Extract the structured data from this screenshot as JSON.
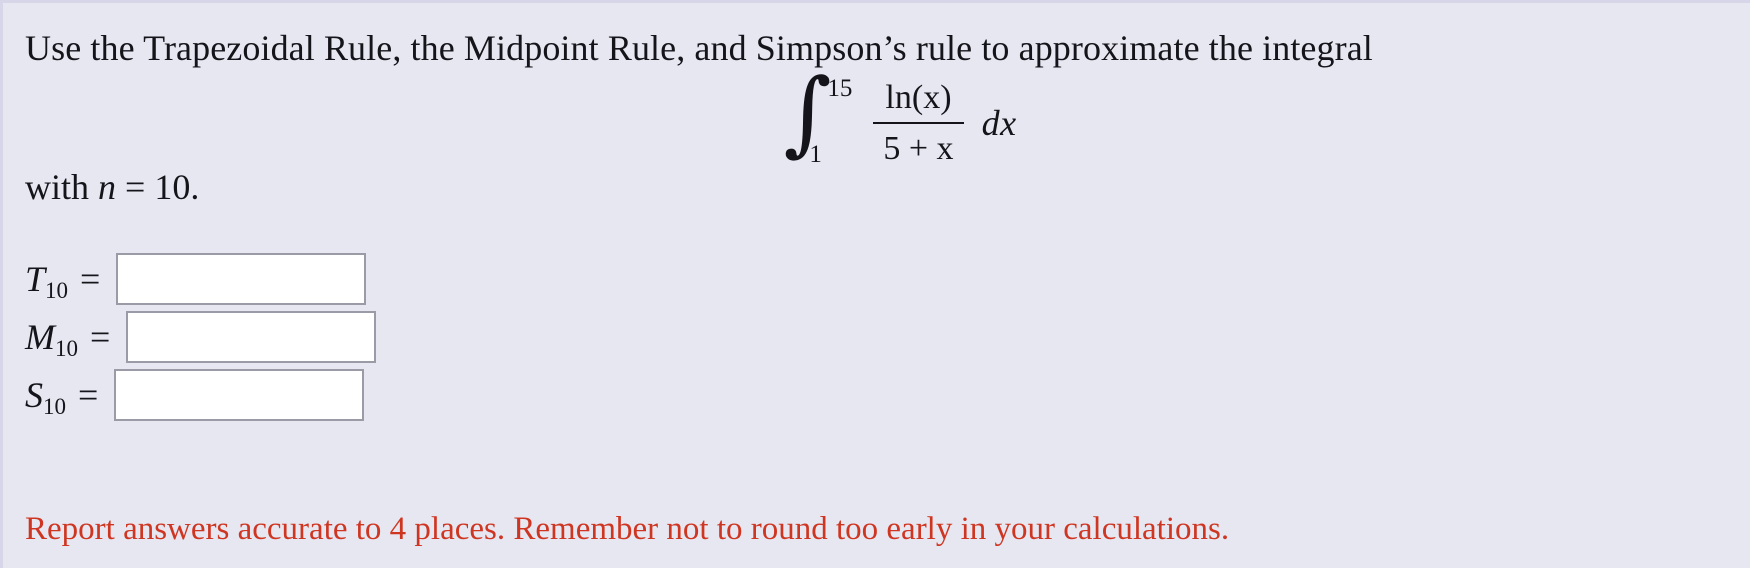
{
  "problem": {
    "prompt": "Use the Trapezoidal Rule, the Midpoint Rule, and Simpson’s rule to approximate the integral",
    "integral": {
      "sign": "∫",
      "lower_limit": "1",
      "upper_limit": "15",
      "numerator": "ln(x)",
      "denominator": "5 + x",
      "differential": "dx"
    },
    "condition_prefix": "with ",
    "condition_var": "n",
    "condition_eq": " = ",
    "condition_value": "10."
  },
  "answers": [
    {
      "id": "trapezoidal",
      "base": "T",
      "sub": "10",
      "eq": "=",
      "value": "",
      "placeholder": ""
    },
    {
      "id": "midpoint",
      "base": "M",
      "sub": "10",
      "eq": "=",
      "value": "",
      "placeholder": ""
    },
    {
      "id": "simpson",
      "base": "S",
      "sub": "10",
      "eq": "=",
      "value": "",
      "placeholder": ""
    }
  ],
  "note": {
    "text": "Report answers accurate to 4 places. Remember not to round too early in your calculations.",
    "color": "#cf3622"
  },
  "colors": {
    "background": "#e7e7f1",
    "border": "#d6d6e8",
    "text": "#14141a",
    "input_border": "#9b9ba8",
    "input_fill": "#ffffff"
  }
}
